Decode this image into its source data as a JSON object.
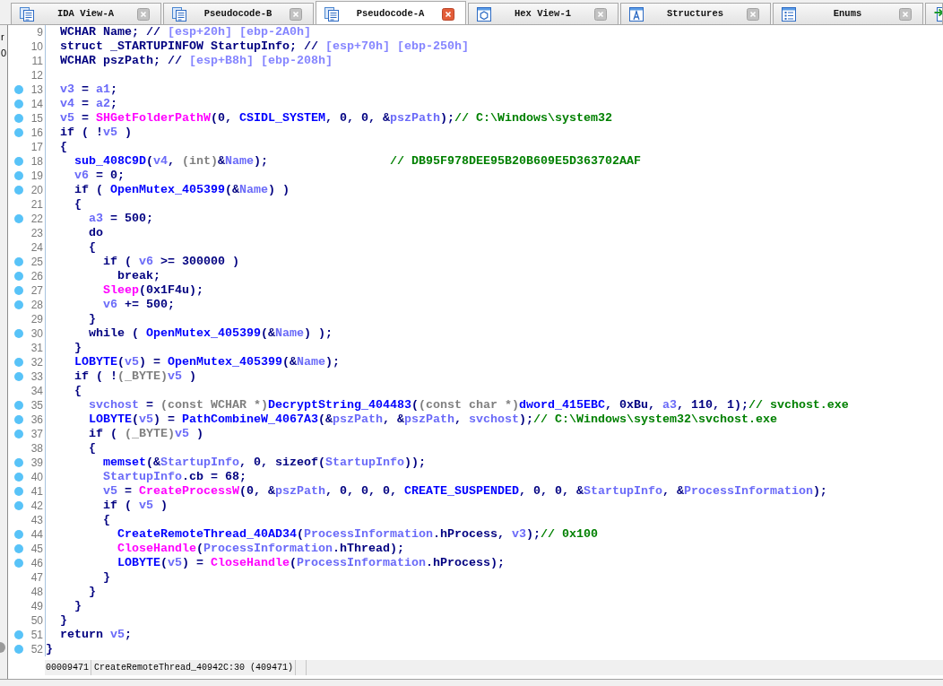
{
  "tabs": [
    {
      "kind": "document",
      "label": "IDA View-A",
      "selected": false
    },
    {
      "kind": "document",
      "label": "Pseudocode-B",
      "selected": false
    },
    {
      "kind": "document",
      "label": "Pseudocode-A",
      "selected": true
    },
    {
      "kind": "hexagon",
      "label": "Hex View-1",
      "selected": false
    },
    {
      "kind": "letter",
      "label": "Structures",
      "selected": false
    },
    {
      "kind": "list",
      "label": "Enums",
      "selected": false
    },
    {
      "kind": "arrow",
      "selected": false
    }
  ],
  "side_panel": {
    "items": [
      "r",
      "0"
    ]
  },
  "code": {
    "lines": [
      {
        "number": "9",
        "dot": false,
        "tokens": [
          {
            "kind": "text",
            "text": "  WCHAR Name; // "
          },
          {
            "kind": "offset",
            "text": "[esp+20h] [ebp-2A0h]"
          }
        ]
      },
      {
        "number": "10",
        "dot": false,
        "tokens": [
          {
            "kind": "text",
            "text": "  struct _STARTUPINFOW StartupInfo; // "
          },
          {
            "kind": "offset",
            "text": "[esp+70h] [ebp-250h]"
          }
        ]
      },
      {
        "number": "11",
        "dot": false,
        "tokens": [
          {
            "kind": "text",
            "text": "  WCHAR pszPath; // "
          },
          {
            "kind": "offset",
            "text": "[esp+B8h] [ebp-208h]"
          }
        ]
      },
      {
        "number": "12",
        "dot": false
      },
      {
        "number": "13",
        "dot": true,
        "tokens": [
          {
            "kind": "local",
            "text": "  v3"
          },
          {
            "kind": "text",
            "text": " = "
          },
          {
            "kind": "local",
            "text": "a1"
          },
          {
            "kind": "text",
            "text": ";"
          }
        ]
      },
      {
        "number": "14",
        "dot": true,
        "tokens": [
          {
            "kind": "local",
            "text": "  v4"
          },
          {
            "kind": "text",
            "text": " = "
          },
          {
            "kind": "local",
            "text": "a2"
          },
          {
            "kind": "text",
            "text": ";"
          }
        ]
      },
      {
        "number": "15",
        "dot": true,
        "tokens": [
          {
            "kind": "local",
            "text": "  v5"
          },
          {
            "kind": "text",
            "text": " = "
          },
          {
            "kind": "import",
            "text": "SHGetFolderPathW"
          },
          {
            "kind": "text",
            "text": "(0, "
          },
          {
            "kind": "name",
            "text": "CSIDL_SYSTEM"
          },
          {
            "kind": "text",
            "text": ", 0, 0, &"
          },
          {
            "kind": "local",
            "text": "pszPath"
          },
          {
            "kind": "text",
            "text": ");"
          },
          {
            "kind": "comment",
            "text": "// C:\\Windows\\system32"
          }
        ]
      },
      {
        "number": "16",
        "dot": true,
        "tokens": [
          {
            "kind": "text",
            "text": "  if ( !"
          },
          {
            "kind": "local",
            "text": "v5"
          },
          {
            "kind": "text",
            "text": " )"
          }
        ]
      },
      {
        "number": "17",
        "dot": false,
        "tokens": [
          {
            "kind": "text",
            "text": "  {"
          }
        ]
      },
      {
        "number": "18",
        "dot": true,
        "tokens": [
          {
            "kind": "name",
            "text": "    sub_408C9D"
          },
          {
            "kind": "text",
            "text": "("
          },
          {
            "kind": "local",
            "text": "v4"
          },
          {
            "kind": "text",
            "text": ", "
          },
          {
            "kind": "cast",
            "text": "(int)"
          },
          {
            "kind": "text",
            "text": "&"
          },
          {
            "kind": "local",
            "text": "Name"
          },
          {
            "kind": "text",
            "text": ");                 "
          },
          {
            "kind": "comment",
            "text": "// DB95F978DEE95B20B609E5D363702AAF"
          }
        ]
      },
      {
        "number": "19",
        "dot": true,
        "tokens": [
          {
            "kind": "local",
            "text": "    v6"
          },
          {
            "kind": "text",
            "text": " = 0;"
          }
        ]
      },
      {
        "number": "20",
        "dot": true,
        "tokens": [
          {
            "kind": "text",
            "text": "    if ( "
          },
          {
            "kind": "name",
            "text": "OpenMutex_405399"
          },
          {
            "kind": "text",
            "text": "(&"
          },
          {
            "kind": "local",
            "text": "Name"
          },
          {
            "kind": "text",
            "text": ") )"
          }
        ]
      },
      {
        "number": "21",
        "dot": false,
        "tokens": [
          {
            "kind": "text",
            "text": "    {"
          }
        ]
      },
      {
        "number": "22",
        "dot": true,
        "tokens": [
          {
            "kind": "local",
            "text": "      a3"
          },
          {
            "kind": "text",
            "text": " = 500;"
          }
        ]
      },
      {
        "number": "23",
        "dot": false,
        "tokens": [
          {
            "kind": "text",
            "text": "      do"
          }
        ]
      },
      {
        "number": "24",
        "dot": false,
        "tokens": [
          {
            "kind": "text",
            "text": "      {"
          }
        ]
      },
      {
        "number": "25",
        "dot": true,
        "tokens": [
          {
            "kind": "text",
            "text": "        if ( "
          },
          {
            "kind": "local",
            "text": "v6"
          },
          {
            "kind": "text",
            "text": " >= 300000 )"
          }
        ]
      },
      {
        "number": "26",
        "dot": true,
        "tokens": [
          {
            "kind": "text",
            "text": "          break;"
          }
        ]
      },
      {
        "number": "27",
        "dot": true,
        "tokens": [
          {
            "kind": "import",
            "text": "        Sleep"
          },
          {
            "kind": "text",
            "text": "(0x1F4u);"
          }
        ]
      },
      {
        "number": "28",
        "dot": true,
        "tokens": [
          {
            "kind": "local",
            "text": "        v6"
          },
          {
            "kind": "text",
            "text": " += 500;"
          }
        ]
      },
      {
        "number": "29",
        "dot": false,
        "tokens": [
          {
            "kind": "text",
            "text": "      }"
          }
        ]
      },
      {
        "number": "30",
        "dot": true,
        "tokens": [
          {
            "kind": "text",
            "text": "      while ( "
          },
          {
            "kind": "name",
            "text": "OpenMutex_405399"
          },
          {
            "kind": "text",
            "text": "(&"
          },
          {
            "kind": "local",
            "text": "Name"
          },
          {
            "kind": "text",
            "text": ") );"
          }
        ]
      },
      {
        "number": "31",
        "dot": false,
        "tokens": [
          {
            "kind": "text",
            "text": "    }"
          }
        ]
      },
      {
        "number": "32",
        "dot": true,
        "tokens": [
          {
            "kind": "name",
            "text": "    LOBYTE"
          },
          {
            "kind": "text",
            "text": "("
          },
          {
            "kind": "local",
            "text": "v5"
          },
          {
            "kind": "text",
            "text": ") = "
          },
          {
            "kind": "name",
            "text": "OpenMutex_405399"
          },
          {
            "kind": "text",
            "text": "(&"
          },
          {
            "kind": "local",
            "text": "Name"
          },
          {
            "kind": "text",
            "text": ");"
          }
        ]
      },
      {
        "number": "33",
        "dot": true,
        "tokens": [
          {
            "kind": "text",
            "text": "    if ( !"
          },
          {
            "kind": "cast",
            "text": "(_BYTE)"
          },
          {
            "kind": "local",
            "text": "v5"
          },
          {
            "kind": "text",
            "text": " )"
          }
        ]
      },
      {
        "number": "34",
        "dot": false,
        "tokens": [
          {
            "kind": "text",
            "text": "    {"
          }
        ]
      },
      {
        "number": "35",
        "dot": true,
        "tokens": [
          {
            "kind": "local",
            "text": "      svchost"
          },
          {
            "kind": "text",
            "text": " = "
          },
          {
            "kind": "cast",
            "text": "(const WCHAR *)"
          },
          {
            "kind": "name",
            "text": "DecryptString_404483"
          },
          {
            "kind": "text",
            "text": "("
          },
          {
            "kind": "cast",
            "text": "(const char *)"
          },
          {
            "kind": "name",
            "text": "dword_415EBC"
          },
          {
            "kind": "text",
            "text": ", 0xBu, "
          },
          {
            "kind": "local",
            "text": "a3"
          },
          {
            "kind": "text",
            "text": ", 110, 1);"
          },
          {
            "kind": "comment",
            "text": "// svchost.exe"
          }
        ]
      },
      {
        "number": "36",
        "dot": true,
        "tokens": [
          {
            "kind": "name",
            "text": "      LOBYTE"
          },
          {
            "kind": "text",
            "text": "("
          },
          {
            "kind": "local",
            "text": "v5"
          },
          {
            "kind": "text",
            "text": ") = "
          },
          {
            "kind": "name",
            "text": "PathCombineW_4067A3"
          },
          {
            "kind": "text",
            "text": "(&"
          },
          {
            "kind": "local",
            "text": "pszPath"
          },
          {
            "kind": "text",
            "text": ", &"
          },
          {
            "kind": "local",
            "text": "pszPath"
          },
          {
            "kind": "text",
            "text": ", "
          },
          {
            "kind": "local",
            "text": "svchost"
          },
          {
            "kind": "text",
            "text": ");"
          },
          {
            "kind": "comment",
            "text": "// C:\\Windows\\system32\\svchost.exe"
          }
        ]
      },
      {
        "number": "37",
        "dot": true,
        "tokens": [
          {
            "kind": "text",
            "text": "      if ( "
          },
          {
            "kind": "cast",
            "text": "(_BYTE)"
          },
          {
            "kind": "local",
            "text": "v5"
          },
          {
            "kind": "text",
            "text": " )"
          }
        ]
      },
      {
        "number": "38",
        "dot": false,
        "tokens": [
          {
            "kind": "text",
            "text": "      {"
          }
        ]
      },
      {
        "number": "39",
        "dot": true,
        "tokens": [
          {
            "kind": "name",
            "text": "        memset"
          },
          {
            "kind": "text",
            "text": "(&"
          },
          {
            "kind": "local",
            "text": "StartupInfo"
          },
          {
            "kind": "text",
            "text": ", 0, sizeof("
          },
          {
            "kind": "local",
            "text": "StartupInfo"
          },
          {
            "kind": "text",
            "text": "));"
          }
        ]
      },
      {
        "number": "40",
        "dot": true,
        "tokens": [
          {
            "kind": "local",
            "text": "        StartupInfo"
          },
          {
            "kind": "text",
            "text": ".cb = 68;"
          }
        ]
      },
      {
        "number": "41",
        "dot": true,
        "tokens": [
          {
            "kind": "local",
            "text": "        v5"
          },
          {
            "kind": "text",
            "text": " = "
          },
          {
            "kind": "import",
            "text": "CreateProcessW"
          },
          {
            "kind": "text",
            "text": "(0, &"
          },
          {
            "kind": "local",
            "text": "pszPath"
          },
          {
            "kind": "text",
            "text": ", 0, 0, 0, "
          },
          {
            "kind": "name",
            "text": "CREATE_SUSPENDED"
          },
          {
            "kind": "text",
            "text": ", 0, 0, &"
          },
          {
            "kind": "local",
            "text": "StartupInfo"
          },
          {
            "kind": "text",
            "text": ", &"
          },
          {
            "kind": "local",
            "text": "ProcessInformation"
          },
          {
            "kind": "text",
            "text": ");"
          }
        ]
      },
      {
        "number": "42",
        "dot": true,
        "tokens": [
          {
            "kind": "text",
            "text": "        if ( "
          },
          {
            "kind": "local",
            "text": "v5"
          },
          {
            "kind": "text",
            "text": " )"
          }
        ]
      },
      {
        "number": "43",
        "dot": false,
        "tokens": [
          {
            "kind": "text",
            "text": "        {"
          }
        ]
      },
      {
        "number": "44",
        "dot": true,
        "tokens": [
          {
            "kind": "name",
            "text": "          CreateRemoteThread_40AD34"
          },
          {
            "kind": "text",
            "text": "("
          },
          {
            "kind": "local",
            "text": "ProcessInformation"
          },
          {
            "kind": "text",
            "text": ".hProcess, "
          },
          {
            "kind": "local",
            "text": "v3"
          },
          {
            "kind": "text",
            "text": ");"
          },
          {
            "kind": "comment",
            "text": "// 0x100"
          }
        ]
      },
      {
        "number": "45",
        "dot": true,
        "tokens": [
          {
            "kind": "import",
            "text": "          CloseHandle"
          },
          {
            "kind": "text",
            "text": "("
          },
          {
            "kind": "local",
            "text": "ProcessInformation"
          },
          {
            "kind": "text",
            "text": ".hThread);"
          }
        ]
      },
      {
        "number": "46",
        "dot": true,
        "tokens": [
          {
            "kind": "name",
            "text": "          LOBYTE"
          },
          {
            "kind": "text",
            "text": "("
          },
          {
            "kind": "local",
            "text": "v5"
          },
          {
            "kind": "text",
            "text": ") = "
          },
          {
            "kind": "import",
            "text": "CloseHandle"
          },
          {
            "kind": "text",
            "text": "("
          },
          {
            "kind": "local",
            "text": "ProcessInformation"
          },
          {
            "kind": "text",
            "text": ".hProcess);"
          }
        ]
      },
      {
        "number": "47",
        "dot": false,
        "tokens": [
          {
            "kind": "text",
            "text": "        }"
          }
        ]
      },
      {
        "number": "48",
        "dot": false,
        "tokens": [
          {
            "kind": "text",
            "text": "      }"
          }
        ]
      },
      {
        "number": "49",
        "dot": false,
        "tokens": [
          {
            "kind": "text",
            "text": "    }"
          }
        ]
      },
      {
        "number": "50",
        "dot": false,
        "tokens": [
          {
            "kind": "text",
            "text": "  }"
          }
        ]
      },
      {
        "number": "51",
        "dot": true,
        "tokens": [
          {
            "kind": "text",
            "text": "  return "
          },
          {
            "kind": "local",
            "text": "v5"
          },
          {
            "kind": "text",
            "text": ";"
          }
        ]
      },
      {
        "number": "52",
        "dot": true,
        "tokens": [
          {
            "kind": "text",
            "text": "}"
          }
        ]
      }
    ]
  },
  "status_bar": {
    "cells": [
      "00009471",
      "CreateRemoteThread_40942C:30 (409471)"
    ]
  }
}
